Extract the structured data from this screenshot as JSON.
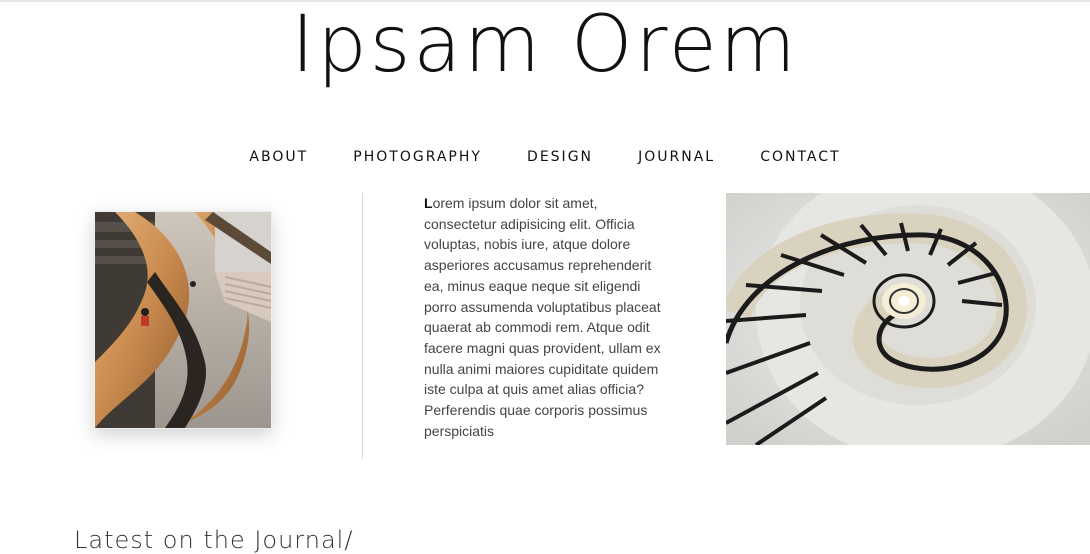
{
  "site": {
    "title": "Ipsam Orem"
  },
  "nav": {
    "items": [
      {
        "label": "ABOUT"
      },
      {
        "label": "PHOTOGRAPHY"
      },
      {
        "label": "DESIGN"
      },
      {
        "label": "JOURNAL"
      },
      {
        "label": "CONTACT"
      }
    ]
  },
  "intro": {
    "drop_letter": "L",
    "text": "orem ipsum dolor sit amet, consectetur adipisicing elit. Officia voluptas, nobis iure, atque dolore asperiores accusamus reprehenderit ea, minus eaque neque sit eligendi porro assumenda voluptatibus placeat quaerat ab commodi rem. Atque odit facere magni quas provident, ullam ex nulla animi maiores cupiditate quidem iste culpa at quis amet alias officia? Perferendis quae corporis possimus perspiciatis"
  },
  "journal": {
    "heading": "Latest on the Journal/"
  }
}
